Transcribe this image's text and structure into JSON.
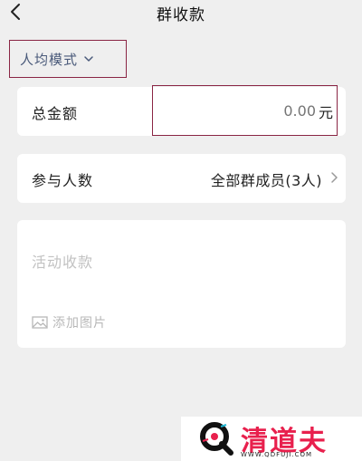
{
  "nav": {
    "title": "群收款",
    "back_icon": "chevron-left-icon"
  },
  "mode": {
    "label": "人均模式",
    "icon": "chevron-down-icon"
  },
  "amount": {
    "label": "总金额",
    "placeholder": "0.00",
    "unit": "元"
  },
  "members": {
    "label": "参与人数",
    "value": "全部群成员(3人)",
    "icon": "chevron-right-icon"
  },
  "note": {
    "placeholder": "活动收款",
    "add_image_label": "添加图片",
    "add_image_icon": "image-icon"
  },
  "watermark": {
    "name": "清道夫",
    "url": "WWW.QDFUJI.COM"
  },
  "colors": {
    "background": "#efefef",
    "card": "#ffffff",
    "highlight_box": "#8a2544",
    "placeholder": "#bbbbbb",
    "watermark_red": "#e8204d"
  }
}
